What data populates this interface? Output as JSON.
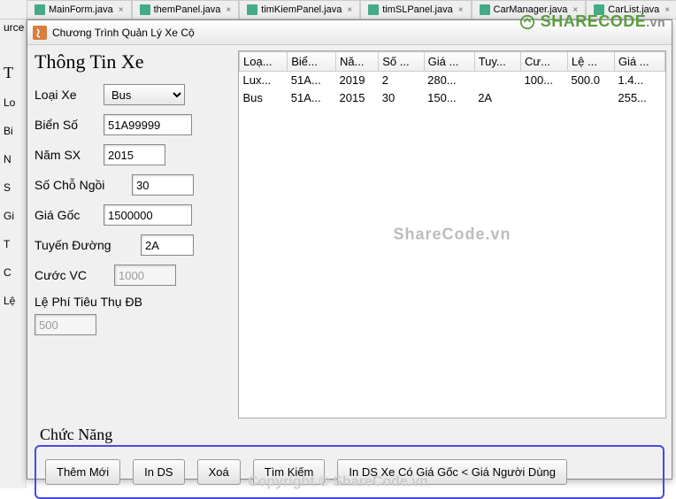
{
  "ide_tabs": [
    {
      "label": "MainForm.java"
    },
    {
      "label": "themPanel.java"
    },
    {
      "label": "timKiemPanel.java"
    },
    {
      "label": "timSLPanel.java"
    },
    {
      "label": "CarManager.java"
    },
    {
      "label": "CarList.java"
    }
  ],
  "window_title": "Chương Trình Quản Lý Xe Cộ",
  "form": {
    "title": "Thông Tin Xe",
    "loai_xe_label": "Loại Xe",
    "loai_xe_value": "Bus",
    "bien_so_label": "Biển Số",
    "bien_so_value": "51A99999",
    "nam_sx_label": "Năm SX",
    "nam_sx_value": "2015",
    "so_cho_label": "Số Chỗ Ngồi",
    "so_cho_value": "30",
    "gia_goc_label": "Giá Gốc",
    "gia_goc_value": "1500000",
    "tuyen_duong_label": "Tuyến Đường",
    "tuyen_duong_value": "2A",
    "cuoc_vc_label": "Cước VC",
    "cuoc_vc_value": "1000",
    "le_phi_label": "Lệ Phí Tiêu Thụ ĐB",
    "le_phi_value": "500"
  },
  "table": {
    "headers": [
      "Loạ...",
      "Biể...",
      "Nă...",
      "Số ...",
      "Giá ...",
      "Tuy...",
      "Cư...",
      "Lệ ...",
      "Giá ..."
    ],
    "rows": [
      [
        "Lux...",
        "51A...",
        "2019",
        "2",
        "280...",
        "",
        "100...",
        "500.0",
        "1.4..."
      ],
      [
        "Bus",
        "51A...",
        "2015",
        "30",
        "150...",
        "2A",
        "",
        "",
        "255..."
      ]
    ]
  },
  "functions": {
    "title": "Chức Năng",
    "buttons": [
      "Thêm Mới",
      "In DS",
      "Xoá",
      "Tìm Kiếm",
      "In DS Xe Có Giá Gốc < Giá Người Dùng"
    ]
  },
  "watermark": "ShareCode.vn",
  "logo": {
    "main": "SHARECODE",
    "ext": ".vn"
  },
  "copyright": "Copyright © ShareCode.vn",
  "bg_labels": [
    "urce",
    "T",
    "Lo",
    "Bi",
    "N",
    "S",
    "Gi",
    "T",
    "C",
    "Lệ"
  ]
}
